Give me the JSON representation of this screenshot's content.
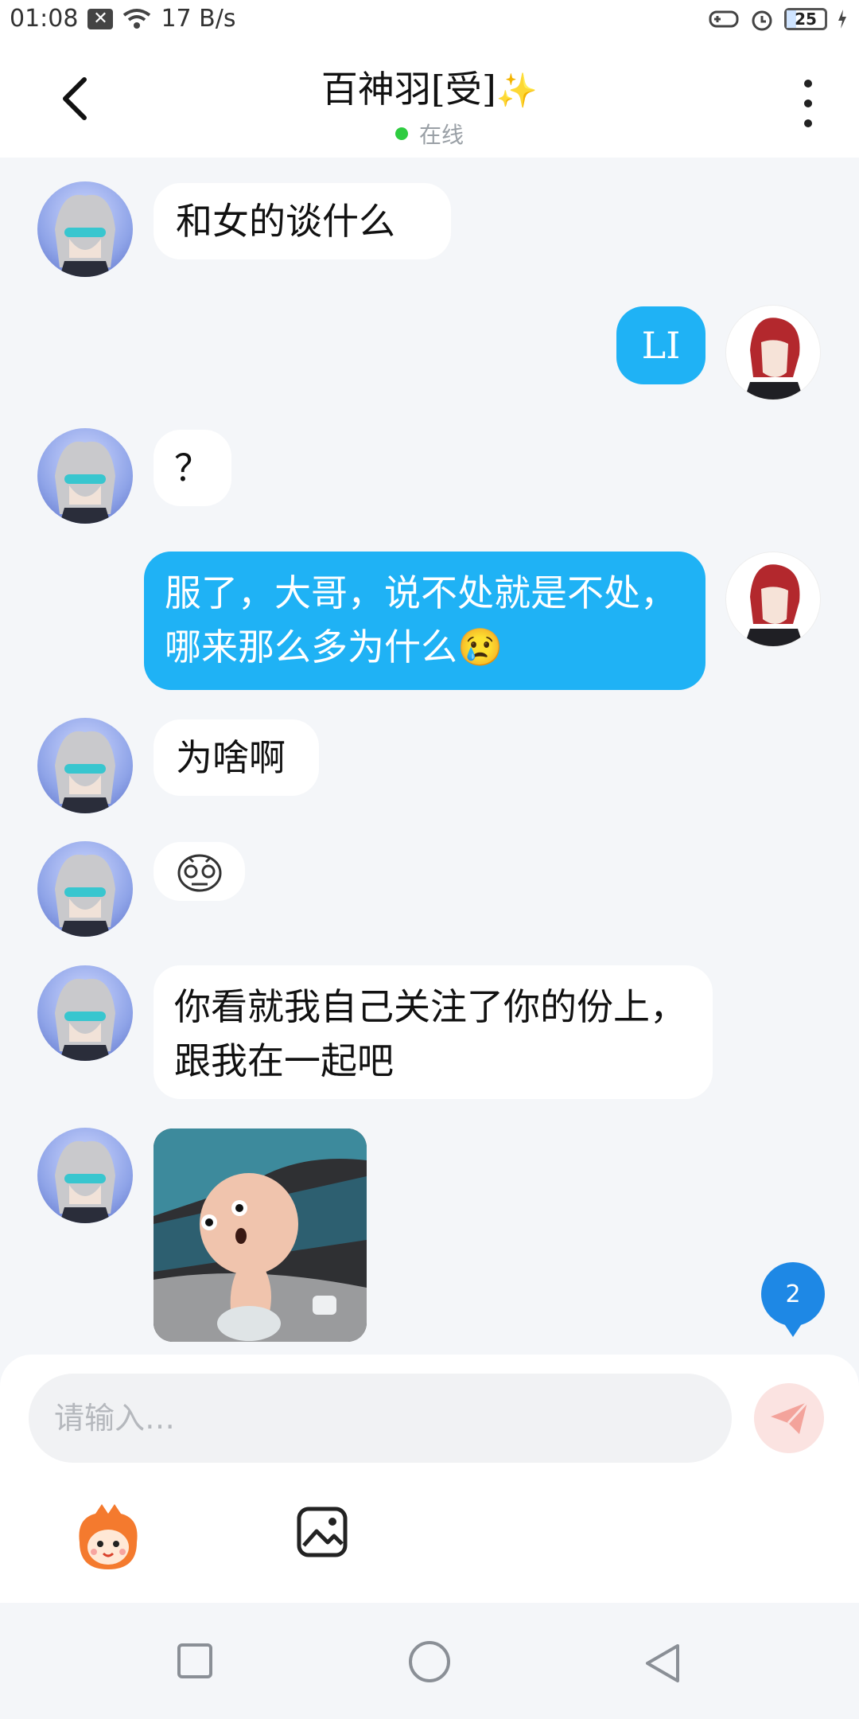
{
  "status_bar": {
    "time": "01:08",
    "network_speed": "17 B/s",
    "battery_level": 25,
    "battery_text": "25"
  },
  "header": {
    "title": "百神羽[受]",
    "title_emoji": "✨",
    "status": "在线"
  },
  "messages": [
    {
      "side": "left",
      "type": "text",
      "text": "和女的谈什么"
    },
    {
      "side": "right",
      "type": "text",
      "text": "LI"
    },
    {
      "side": "left",
      "type": "text",
      "text": "？"
    },
    {
      "side": "right",
      "type": "text",
      "text": "服了，大哥，说不处就是不处，哪来那么多为什么😢"
    },
    {
      "side": "left",
      "type": "text",
      "text": "为啥啊"
    },
    {
      "side": "left",
      "type": "sticker",
      "icon": "crying-face-sticker-icon"
    },
    {
      "side": "left",
      "type": "text",
      "text": "你看就我自己关注了你的份上，跟我在一起吧"
    },
    {
      "side": "left",
      "type": "image",
      "icon": "meme-image"
    }
  ],
  "unread_badge": "2",
  "input": {
    "placeholder": "请输入…"
  },
  "colors": {
    "my_bubble": "#1fb2f5",
    "other_bubble": "#ffffff",
    "background": "#f4f6f9",
    "online": "#2ecc40",
    "badge": "#1e88e5"
  },
  "icons": {
    "back": "chevron-left-icon",
    "more": "more-vertical-icon",
    "send": "send-icon",
    "emoji": "emoji-mascot-icon",
    "image": "image-icon",
    "nav": [
      "square-icon",
      "circle-icon",
      "triangle-back-icon"
    ]
  }
}
